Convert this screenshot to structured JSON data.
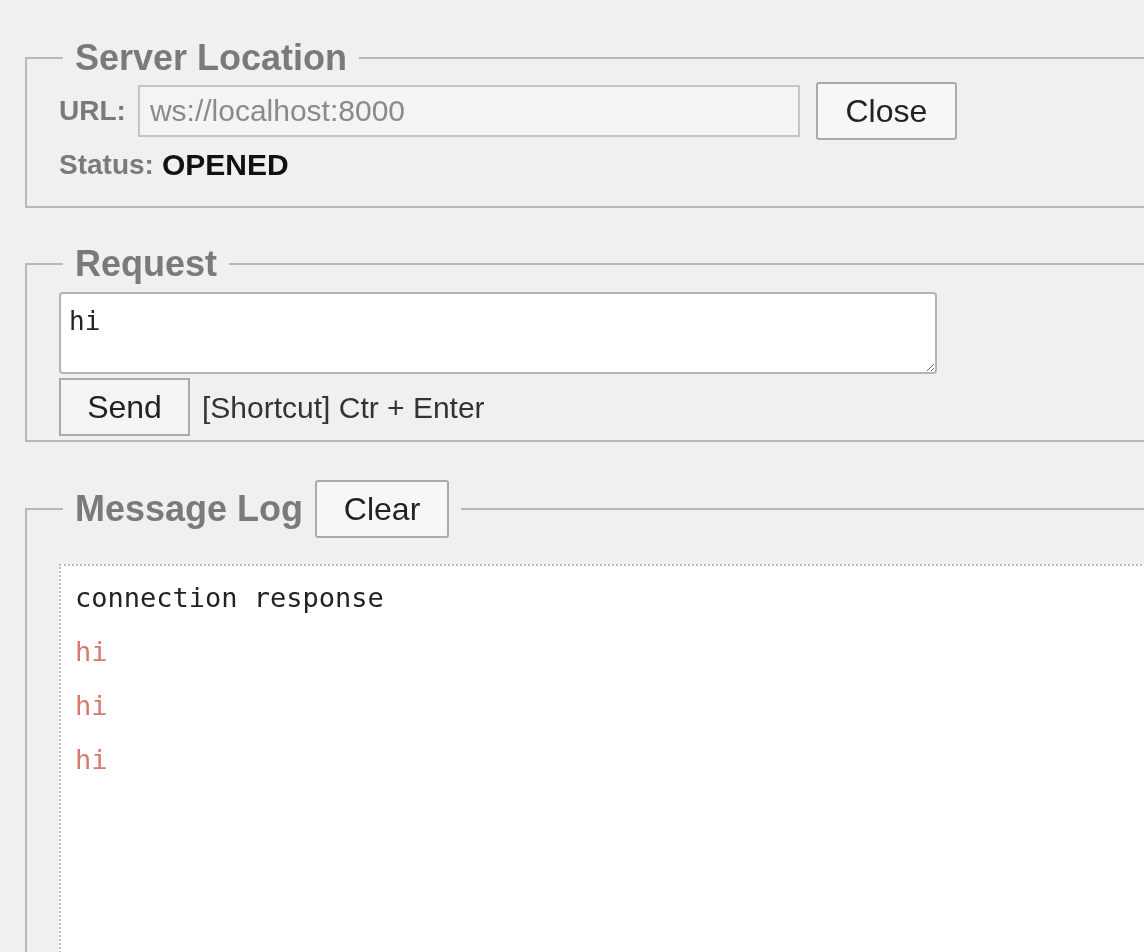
{
  "server_location": {
    "legend": "Server Location",
    "url_label": "URL:",
    "url_value": "ws://localhost:8000",
    "url_disabled": true,
    "close_button": "Close",
    "status_label": "Status:",
    "status_value": "OPENED"
  },
  "request": {
    "legend": "Request",
    "value": "hi",
    "send_button": "Send",
    "shortcut_hint": "[Shortcut] Ctr + Enter"
  },
  "message_log": {
    "legend": "Message Log",
    "clear_button": "Clear",
    "entries": [
      {
        "kind": "received",
        "text": "connection response"
      },
      {
        "kind": "sent",
        "text": "hi"
      },
      {
        "kind": "sent",
        "text": "hi"
      },
      {
        "kind": "sent",
        "text": "hi"
      }
    ]
  }
}
